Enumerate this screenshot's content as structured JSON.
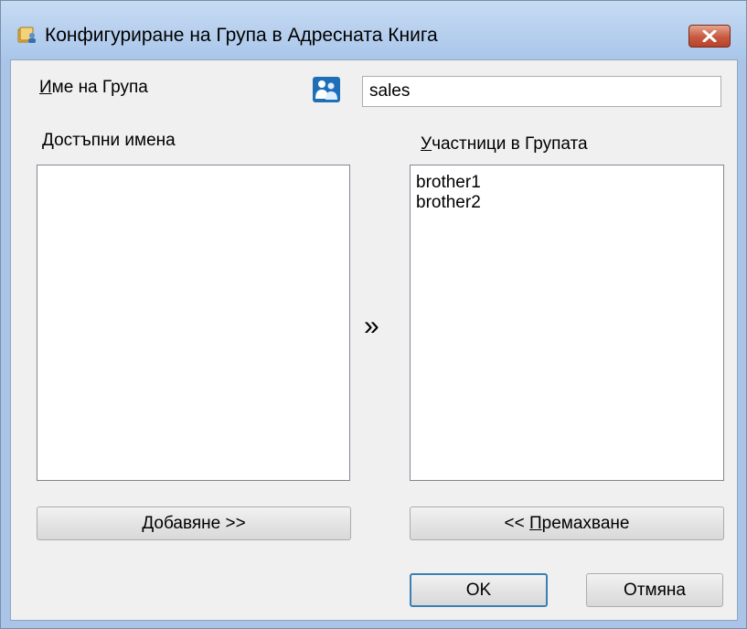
{
  "window": {
    "title": "Конфигуриране на Група в Адресната Книга",
    "icon": "address-book-icon",
    "close_icon": "close-icon"
  },
  "group_name": {
    "label_accel": "И",
    "label_rest": "ме на Група",
    "icon": "group-people-icon",
    "value": "sales"
  },
  "available": {
    "label_accel": "Д",
    "label_rest": "остъпни имена",
    "items": []
  },
  "members": {
    "label_accel": "У",
    "label_rest": "частници в Групата",
    "items": [
      "brother1",
      "brother2"
    ]
  },
  "transfer_glyph": "»",
  "buttons": {
    "add_accel": "Д",
    "add_rest": "обавяне >>",
    "remove_prefix": "<< ",
    "remove_accel": "П",
    "remove_rest": "ремахване",
    "ok": "OK",
    "cancel": "Отмяна"
  },
  "colors": {
    "title_bar": "#a9c6ea",
    "close_button": "#c65a3f",
    "client_bg": "#f0f0f0",
    "default_button_border": "#3c7fb1"
  }
}
